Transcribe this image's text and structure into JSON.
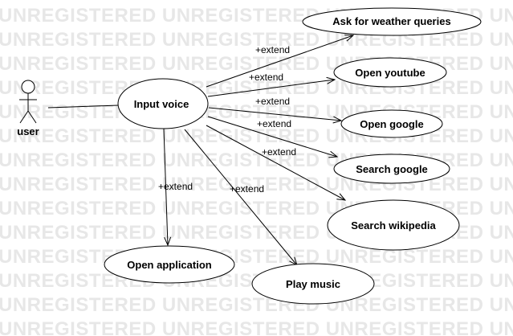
{
  "watermark": {
    "text": "UNREGISTERED"
  },
  "actor": {
    "label": "user"
  },
  "use_cases": {
    "input_voice": "Input voice",
    "weather": "Ask for weather queries",
    "youtube": "Open youtube",
    "google": "Open google",
    "search_google": "Search google",
    "wikipedia": "Search wikipedia",
    "application": "Open application",
    "music": "Play music"
  },
  "relations": {
    "extend_label": "+extend"
  },
  "colors": {
    "stroke": "#000000",
    "fill": "#ffffff",
    "watermark": "#e7e7e7"
  }
}
